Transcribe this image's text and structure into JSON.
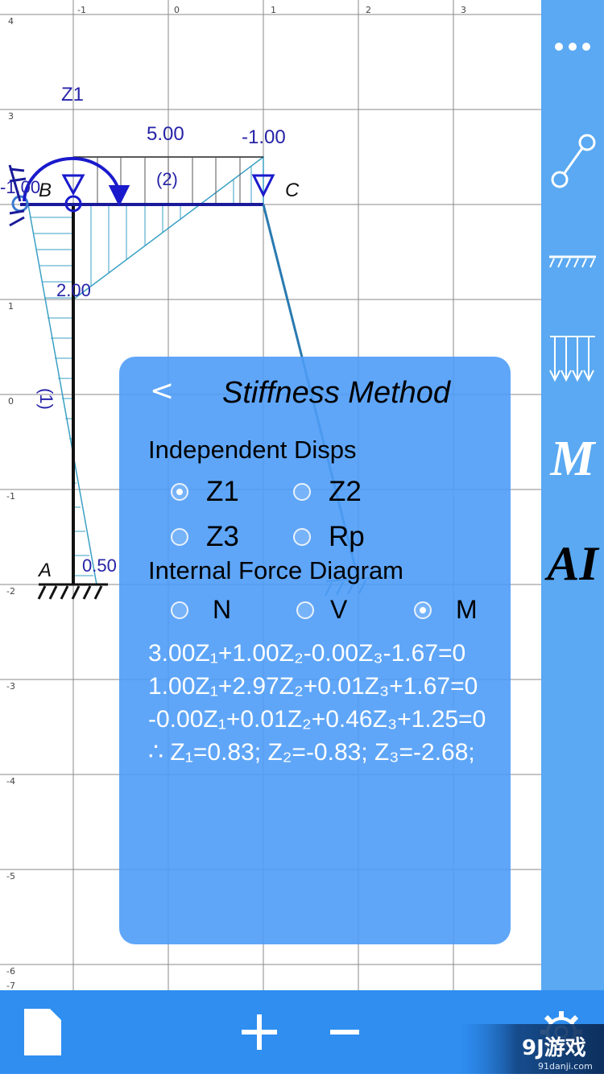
{
  "grid": {
    "x_ticks": [
      "-1",
      "0",
      "1",
      "2",
      "3"
    ],
    "y_ticks": [
      "4",
      "3",
      "1",
      "0",
      "-1",
      "-2",
      "-3",
      "-4",
      "-5",
      "-6",
      "-7"
    ]
  },
  "structure": {
    "label_z1": "Z1",
    "load_value": "5.00",
    "moment_c": "-1.00",
    "label_b": "B",
    "label_c": "C",
    "label_a": "A",
    "member_2": "(2)",
    "member_1": "(1)",
    "moment_b_left": "-1.00",
    "moment_b_col": "2.00",
    "moment_a": "0.50"
  },
  "toolbar_right": {
    "more_icon": "more-dots-icon",
    "member_icon": "member-link-icon",
    "support_icon": "fixed-support-icon",
    "load_icon": "distributed-load-icon",
    "moment_label": "M",
    "ai_label": "AI"
  },
  "toolbar_bottom": {
    "new_icon": "document-icon",
    "add_label": "+",
    "remove_label": "−",
    "settings_icon": "gear-icon"
  },
  "panel": {
    "back": "<",
    "title": "Stiffness Method",
    "disps_title": "Independent Disps",
    "disps": [
      {
        "label": "Z1",
        "selected": true
      },
      {
        "label": "Z2",
        "selected": false
      },
      {
        "label": "Z3",
        "selected": false
      },
      {
        "label": "Rp",
        "selected": false
      }
    ],
    "force_title": "Internal Force Diagram",
    "forces": [
      {
        "label": "N",
        "selected": false
      },
      {
        "label": "V",
        "selected": false
      },
      {
        "label": "M",
        "selected": true
      }
    ],
    "equations": [
      "3.00Z₁+1.00Z₂-0.00Z₃-1.67=0",
      "1.00Z₁+2.97Z₂+0.01Z₃+1.67=0",
      "-0.00Z₁+0.01Z₂+0.46Z₃+1.25=0",
      "∴ Z₁=0.83; Z₂=-0.83; Z₃=-2.68;"
    ]
  },
  "watermark": {
    "logo": "9J游戏",
    "site": "91danji.com"
  }
}
